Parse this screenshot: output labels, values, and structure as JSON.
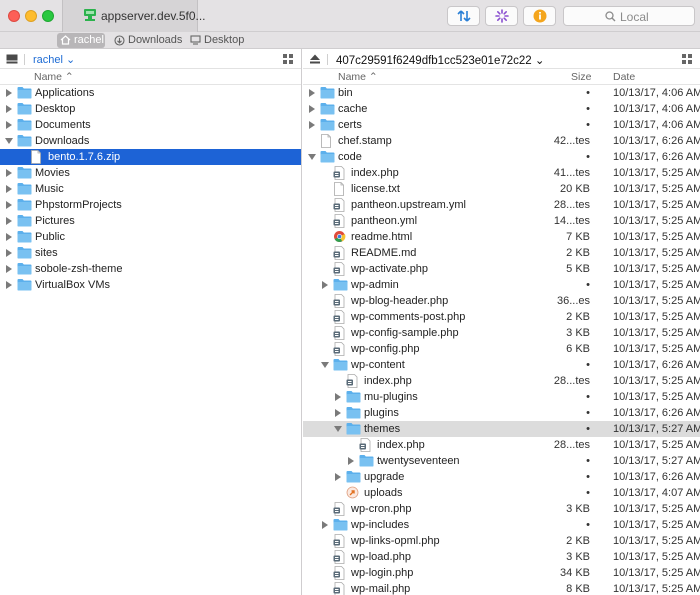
{
  "window": {
    "tab_title": "appserver.dev.5f0...",
    "search_placeholder": "Local"
  },
  "favorites": [
    {
      "label": "rachel",
      "icon": "home-icon",
      "active": true
    },
    {
      "label": "Downloads",
      "icon": "download-icon",
      "active": false
    },
    {
      "label": "Desktop",
      "icon": "desktop-icon",
      "active": false
    }
  ],
  "left_pane": {
    "path": "rachel",
    "col_name": "Name",
    "items": [
      {
        "name": "Applications",
        "type": "folder",
        "depth": 0,
        "state": "closed"
      },
      {
        "name": "Desktop",
        "type": "folder",
        "depth": 0,
        "state": "closed"
      },
      {
        "name": "Documents",
        "type": "folder",
        "depth": 0,
        "state": "closed"
      },
      {
        "name": "Downloads",
        "type": "folder",
        "depth": 0,
        "state": "open"
      },
      {
        "name": "bento.1.7.6.zip",
        "type": "file",
        "depth": 1,
        "state": "none",
        "selected": true
      },
      {
        "name": "Movies",
        "type": "folder",
        "depth": 0,
        "state": "closed"
      },
      {
        "name": "Music",
        "type": "folder",
        "depth": 0,
        "state": "closed"
      },
      {
        "name": "PhpstormProjects",
        "type": "folder",
        "depth": 0,
        "state": "closed"
      },
      {
        "name": "Pictures",
        "type": "folder",
        "depth": 0,
        "state": "closed"
      },
      {
        "name": "Public",
        "type": "folder",
        "depth": 0,
        "state": "closed"
      },
      {
        "name": "sites",
        "type": "folder",
        "depth": 0,
        "state": "closed"
      },
      {
        "name": "sobole-zsh-theme",
        "type": "folder",
        "depth": 0,
        "state": "closed"
      },
      {
        "name": "VirtualBox VMs",
        "type": "folder",
        "depth": 0,
        "state": "closed"
      }
    ]
  },
  "right_pane": {
    "path": "407c29591f6249dfb1cc523e01e72c22",
    "col_name": "Name",
    "col_size": "Size",
    "col_date": "Date",
    "items": [
      {
        "name": "bin",
        "type": "folder",
        "depth": 0,
        "state": "closed",
        "size": "•",
        "date": "10/13/17, 4:06 AM"
      },
      {
        "name": "cache",
        "type": "folder",
        "depth": 0,
        "state": "closed",
        "size": "•",
        "date": "10/13/17, 4:06 AM"
      },
      {
        "name": "certs",
        "type": "folder",
        "depth": 0,
        "state": "closed",
        "size": "•",
        "date": "10/13/17, 4:06 AM"
      },
      {
        "name": "chef.stamp",
        "type": "file",
        "depth": 0,
        "state": "none",
        "size": "42...tes",
        "date": "10/13/17, 6:26 AM"
      },
      {
        "name": "code",
        "type": "folder",
        "depth": 0,
        "state": "open",
        "size": "•",
        "date": "10/13/17, 6:26 AM"
      },
      {
        "name": "index.php",
        "type": "php",
        "depth": 1,
        "state": "none",
        "size": "41...tes",
        "date": "10/13/17, 5:25 AM"
      },
      {
        "name": "license.txt",
        "type": "file",
        "depth": 1,
        "state": "none",
        "size": "20 KB",
        "date": "10/13/17, 5:25 AM"
      },
      {
        "name": "pantheon.upstream.yml",
        "type": "php",
        "depth": 1,
        "state": "none",
        "size": "28...tes",
        "date": "10/13/17, 5:25 AM"
      },
      {
        "name": "pantheon.yml",
        "type": "php",
        "depth": 1,
        "state": "none",
        "size": "14...tes",
        "date": "10/13/17, 5:25 AM"
      },
      {
        "name": "readme.html",
        "type": "chrome",
        "depth": 1,
        "state": "none",
        "size": "7 KB",
        "date": "10/13/17, 5:25 AM"
      },
      {
        "name": "README.md",
        "type": "php",
        "depth": 1,
        "state": "none",
        "size": "2 KB",
        "date": "10/13/17, 5:25 AM"
      },
      {
        "name": "wp-activate.php",
        "type": "php",
        "depth": 1,
        "state": "none",
        "size": "5 KB",
        "date": "10/13/17, 5:25 AM"
      },
      {
        "name": "wp-admin",
        "type": "folder",
        "depth": 1,
        "state": "closed",
        "size": "•",
        "date": "10/13/17, 5:25 AM"
      },
      {
        "name": "wp-blog-header.php",
        "type": "php",
        "depth": 1,
        "state": "none",
        "size": "36...es",
        "date": "10/13/17, 5:25 AM"
      },
      {
        "name": "wp-comments-post.php",
        "type": "php",
        "depth": 1,
        "state": "none",
        "size": "2 KB",
        "date": "10/13/17, 5:25 AM"
      },
      {
        "name": "wp-config-sample.php",
        "type": "php",
        "depth": 1,
        "state": "none",
        "size": "3 KB",
        "date": "10/13/17, 5:25 AM"
      },
      {
        "name": "wp-config.php",
        "type": "php",
        "depth": 1,
        "state": "none",
        "size": "6 KB",
        "date": "10/13/17, 5:25 AM"
      },
      {
        "name": "wp-content",
        "type": "folder",
        "depth": 1,
        "state": "open",
        "size": "•",
        "date": "10/13/17, 6:26 AM"
      },
      {
        "name": "index.php",
        "type": "php",
        "depth": 2,
        "state": "none",
        "size": "28...tes",
        "date": "10/13/17, 5:25 AM"
      },
      {
        "name": "mu-plugins",
        "type": "folder",
        "depth": 2,
        "state": "closed",
        "size": "•",
        "date": "10/13/17, 5:25 AM"
      },
      {
        "name": "plugins",
        "type": "folder",
        "depth": 2,
        "state": "closed",
        "size": "•",
        "date": "10/13/17, 6:26 AM"
      },
      {
        "name": "themes",
        "type": "folder",
        "depth": 2,
        "state": "open",
        "size": "•",
        "date": "10/13/17, 5:27 AM",
        "highlight": true
      },
      {
        "name": "index.php",
        "type": "php",
        "depth": 3,
        "state": "none",
        "size": "28...tes",
        "date": "10/13/17, 5:25 AM"
      },
      {
        "name": "twentyseventeen",
        "type": "folder",
        "depth": 3,
        "state": "closed",
        "size": "•",
        "date": "10/13/17, 5:27 AM"
      },
      {
        "name": "upgrade",
        "type": "folder",
        "depth": 2,
        "state": "closed",
        "size": "•",
        "date": "10/13/17, 6:26 AM"
      },
      {
        "name": "uploads",
        "type": "alias",
        "depth": 2,
        "state": "none",
        "size": "•",
        "date": "10/13/17, 4:07 AM"
      },
      {
        "name": "wp-cron.php",
        "type": "php",
        "depth": 1,
        "state": "none",
        "size": "3 KB",
        "date": "10/13/17, 5:25 AM"
      },
      {
        "name": "wp-includes",
        "type": "folder",
        "depth": 1,
        "state": "closed",
        "size": "•",
        "date": "10/13/17, 5:25 AM"
      },
      {
        "name": "wp-links-opml.php",
        "type": "php",
        "depth": 1,
        "state": "none",
        "size": "2 KB",
        "date": "10/13/17, 5:25 AM"
      },
      {
        "name": "wp-load.php",
        "type": "php",
        "depth": 1,
        "state": "none",
        "size": "3 KB",
        "date": "10/13/17, 5:25 AM"
      },
      {
        "name": "wp-login.php",
        "type": "php",
        "depth": 1,
        "state": "none",
        "size": "34 KB",
        "date": "10/13/17, 5:25 AM"
      },
      {
        "name": "wp-mail.php",
        "type": "php",
        "depth": 1,
        "state": "none",
        "size": "8 KB",
        "date": "10/13/17, 5:25 AM"
      }
    ]
  },
  "colors": {
    "selection": "#1d63d6",
    "folder": "#5cb0ec",
    "highlight": "#dcdcdc"
  }
}
